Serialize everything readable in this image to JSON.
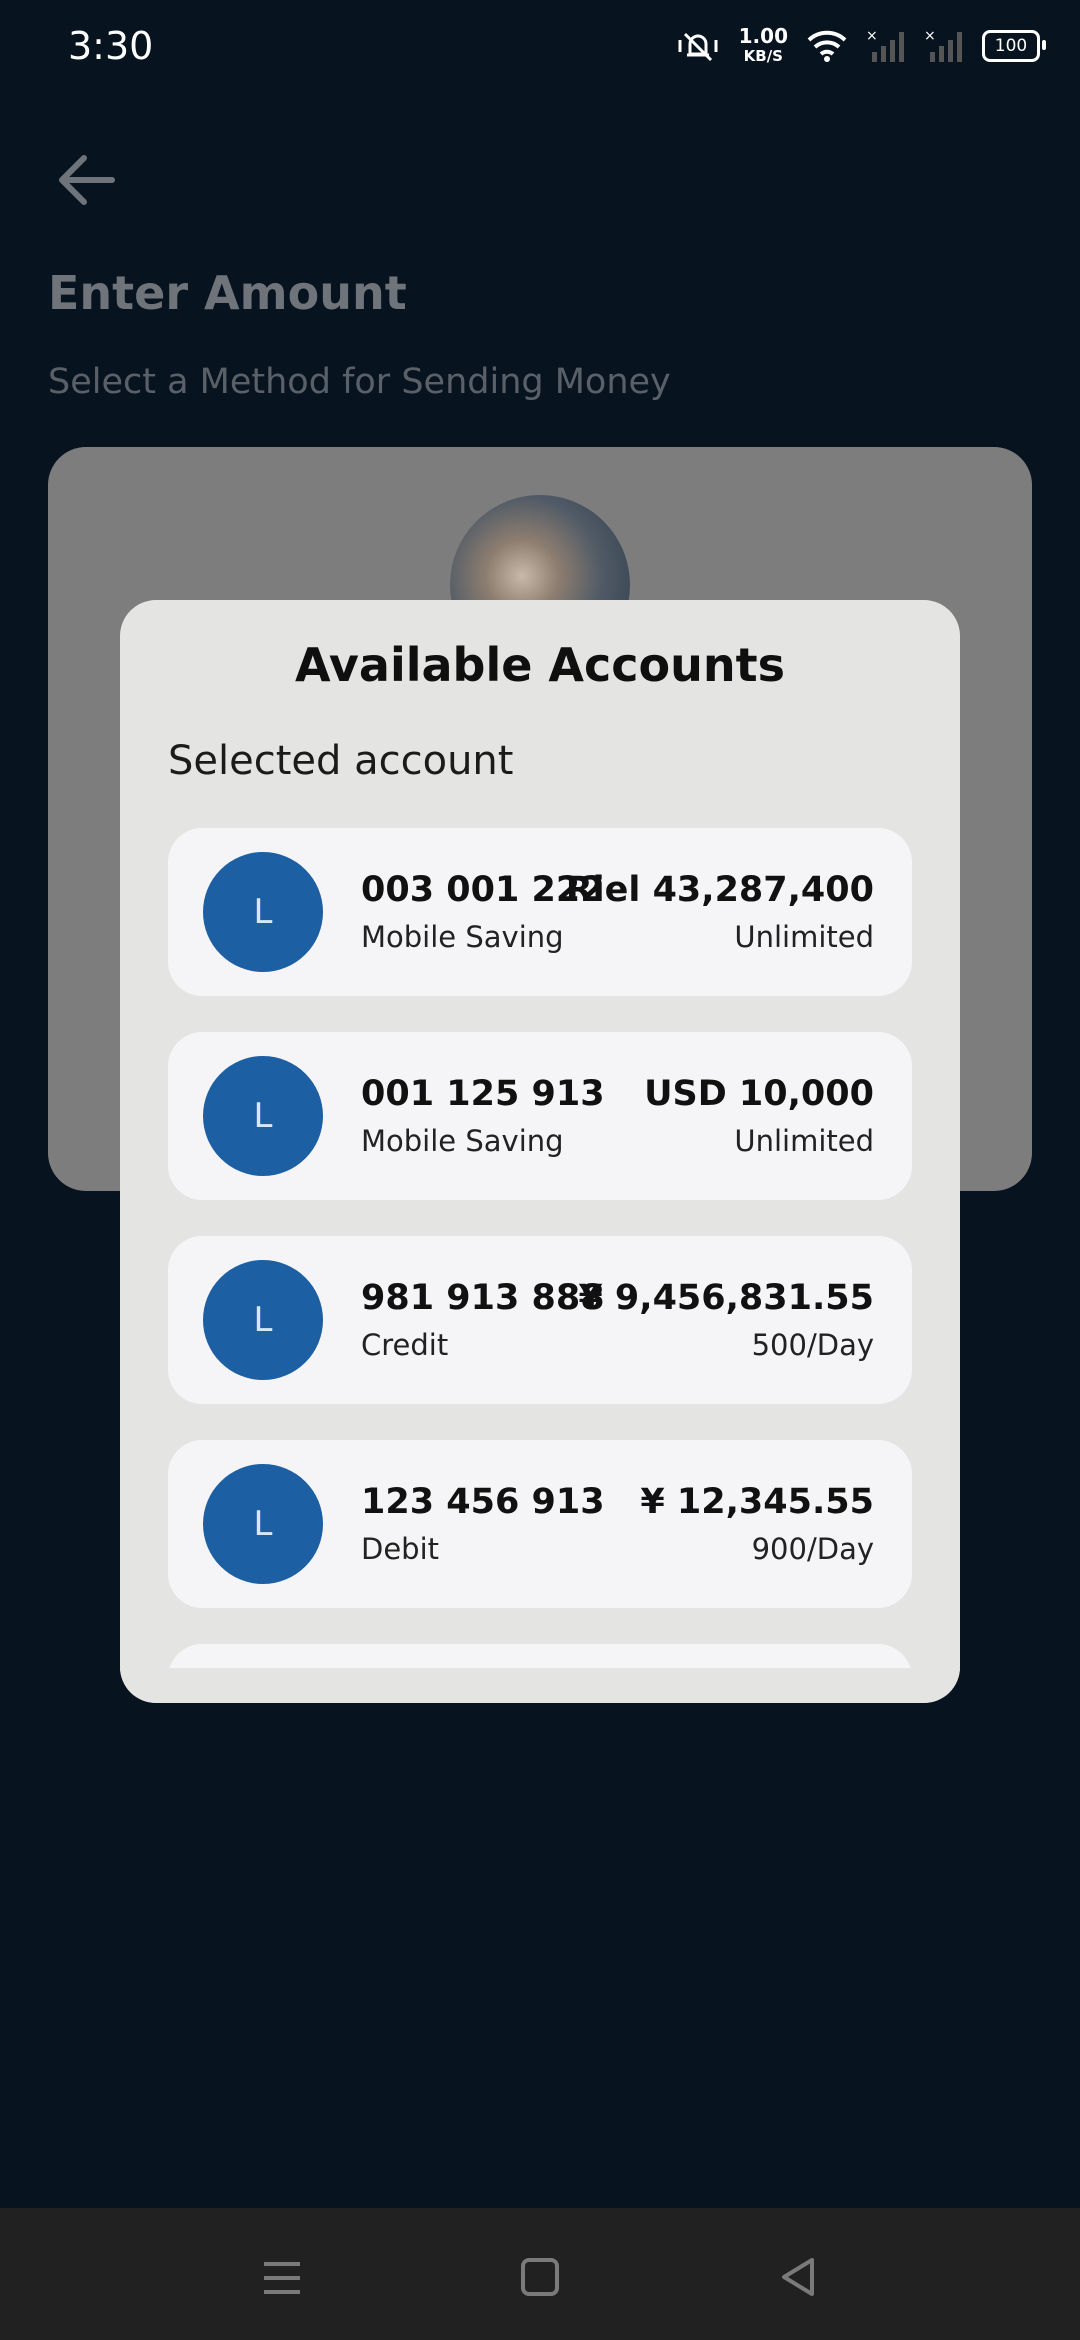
{
  "status_bar": {
    "time": "3:30",
    "net_speed_value": "1.00",
    "net_speed_unit": "KB/S",
    "battery": "100"
  },
  "header": {
    "title": "Enter Amount",
    "subtitle": "Select a Method for Sending Money"
  },
  "modal": {
    "title": "Available Accounts",
    "section_label": "Selected account",
    "accounts": [
      {
        "avatar": "L",
        "number": "003 001 222",
        "type": "Mobile Saving",
        "balance": "Riel 43,287,400",
        "limit": "Unlimited"
      },
      {
        "avatar": "L",
        "number": "001 125 913",
        "type": "Mobile Saving",
        "balance": "USD 10,000",
        "limit": "Unlimited"
      },
      {
        "avatar": "L",
        "number": "981 913 888",
        "type": "Credit",
        "balance": "¥ 9,456,831.55",
        "limit": "500/Day"
      },
      {
        "avatar": "L",
        "number": "123 456 913",
        "type": "Debit",
        "balance": "¥ 12,345.55",
        "limit": "900/Day"
      }
    ]
  },
  "icons": {
    "back": "arrow-left-icon",
    "nav_menu": "menu-icon",
    "nav_home": "home-square-icon",
    "nav_back": "back-triangle-icon"
  },
  "colors": {
    "background": "#081320",
    "avatar": "#1c5fa3",
    "modal": "#e4e4e3",
    "card": "#f5f5f8"
  }
}
